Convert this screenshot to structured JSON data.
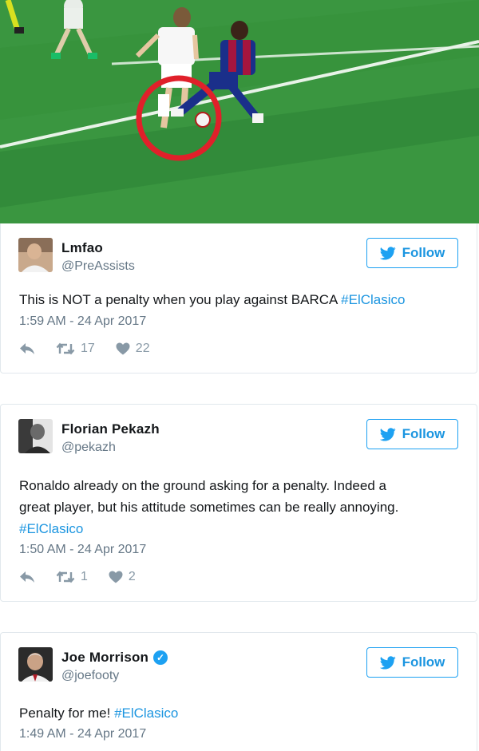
{
  "tweets": [
    {
      "name": "Lmfao",
      "handle": "@PreAssists",
      "text": "This is NOT a penalty when you play against BARCA ",
      "hashtag": "#ElClasico",
      "timestamp": "1:59 AM - 24 Apr 2017",
      "retweets": "17",
      "likes": "22",
      "follow_label": "Follow"
    },
    {
      "name": "Florian Pekazh",
      "handle": "@pekazh",
      "text_line1": "Ronaldo already on the ground asking for a penalty. Indeed a",
      "text_line2": "great player, but his attitude sometimes can be really annoying.",
      "hashtag": "#ElClasico",
      "timestamp": "1:50 AM - 24 Apr 2017",
      "retweets": "1",
      "likes": "2",
      "follow_label": "Follow"
    },
    {
      "name": "Joe Morrison",
      "handle": "@joefooty",
      "verified": "✓",
      "text": "Penalty for me! ",
      "hashtag": "#ElClasico",
      "timestamp": "1:49 AM - 24 Apr 2017",
      "follow_label": "Follow"
    }
  ],
  "colors": {
    "link": "#1b95e0",
    "muted": "#657786",
    "icon": "#8899a6",
    "pitch": "#2f8a35",
    "highlight_circle": "#e0202a"
  },
  "icons": {
    "follow": "bird-icon",
    "reply": "reply-icon",
    "retweet": "retweet-icon",
    "like": "heart-icon",
    "verified": "verified-badge-icon"
  }
}
